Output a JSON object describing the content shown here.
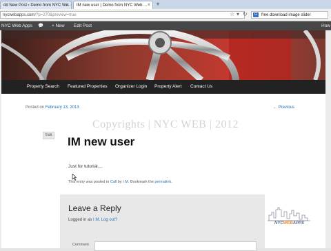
{
  "browser": {
    "tabs": [
      {
        "label": "dd New Post ‹ Demo from NYC We..."
      },
      {
        "label": "IM new user | Demo from NYC Web ..."
      }
    ],
    "new_tab_symbol": "+",
    "url_host": "nycwebapps.com",
    "url_path": "/?p=270&preview=true",
    "search_query": "free download image slider",
    "search_engine_icon": "G"
  },
  "admin_bar": {
    "site_name": "NYC Web Apps",
    "new_label": "+ New",
    "edit_label": "Edit Post",
    "right_label": "How"
  },
  "nav": {
    "items": [
      "Property Search",
      "Featured Properties",
      "Organizer Login",
      "Property Alert",
      "Contact Us"
    ]
  },
  "post": {
    "posted_on": "Posted on",
    "date": "February 13, 2013",
    "previous_link": "← Previous",
    "watermark": "Copyrights | NYC WEB | 2012",
    "edit_label": "Edit",
    "title": "IM new user",
    "body": "Just for tutorial....",
    "footer_prefix": "This entry was posted in",
    "footer_category": "Call",
    "footer_by": "by",
    "footer_author": "I M",
    "footer_bookmark": ". Bookmark the",
    "footer_permalink": "permalink",
    "footer_end": "."
  },
  "reply": {
    "title": "Leave a Reply",
    "logged_prefix": "Logged in as",
    "user": "I M",
    "logout": "Log out?",
    "comment_label": "Comment"
  },
  "logo": {
    "text_nyc": "NYC",
    "text_web": "WEB",
    "text_apps": "APPS"
  },
  "colors": {
    "link": "#1f6fb5",
    "admin_bar": "#464646",
    "nav_bar": "#222222"
  }
}
